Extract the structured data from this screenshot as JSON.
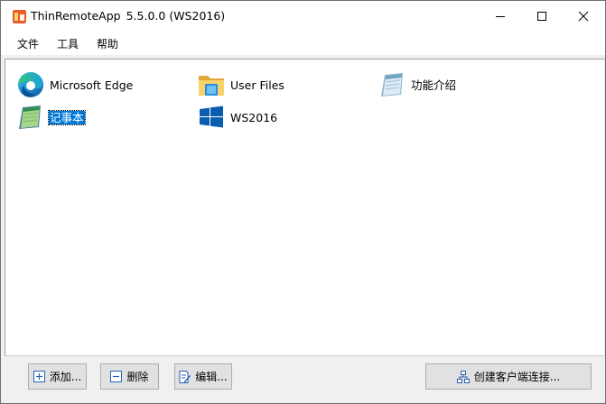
{
  "window": {
    "title": "ThinRemoteApp",
    "version": "5.5.0.0 (WS2016)",
    "controls": {
      "minimize": "minimize-icon",
      "maximize": "maximize-icon",
      "close": "close-icon"
    }
  },
  "menu": [
    "文件",
    "工具",
    "帮助"
  ],
  "apps": [
    {
      "label": "Microsoft Edge",
      "icon": "edge-icon",
      "selected": false
    },
    {
      "label": "User Files",
      "icon": "folder-icon",
      "selected": false
    },
    {
      "label": "功能介绍",
      "icon": "notepad-icon",
      "selected": false
    },
    {
      "label": "记事本",
      "icon": "notepad-icon",
      "selected": true
    },
    {
      "label": "WS2016",
      "icon": "windows-logo-icon",
      "selected": false
    }
  ],
  "buttons": {
    "add": "添加...",
    "delete": "删除",
    "edit": "编辑...",
    "create_connection": "创建客户端连接..."
  },
  "colors": {
    "selection": "#0078d7",
    "app_icon": "#e85d2a",
    "windows_blue": "#0a5eb0"
  }
}
